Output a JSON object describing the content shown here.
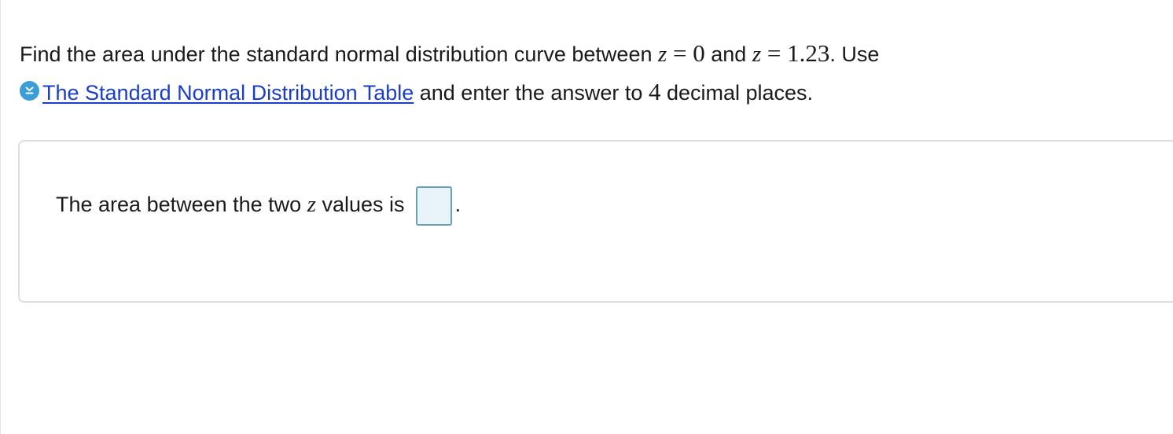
{
  "question": {
    "line1_text": "Find the area under the standard normal distribution curve between ",
    "var_z": "z",
    "eq1_rhs": " = 0",
    "and_text": " and ",
    "eq2_rhs": " = 1.23",
    "line1_end": ". Use",
    "icon": "expand-chevron-icon",
    "link_text": "The Standard Normal Distribution Table",
    "line2_a": " and enter the answer to ",
    "decimals": "4",
    "line2_b": " decimal places."
  },
  "answer": {
    "prefix": "The area between the two ",
    "var_z": "z",
    "suffix": " values is",
    "input_value": "",
    "period": "."
  },
  "colors": {
    "link": "#1a3ec8",
    "icon_bg": "#3b9fd6",
    "input_border": "#6aa0b4",
    "input_bg": "#e8f3fa",
    "card_border": "#dddddd"
  }
}
